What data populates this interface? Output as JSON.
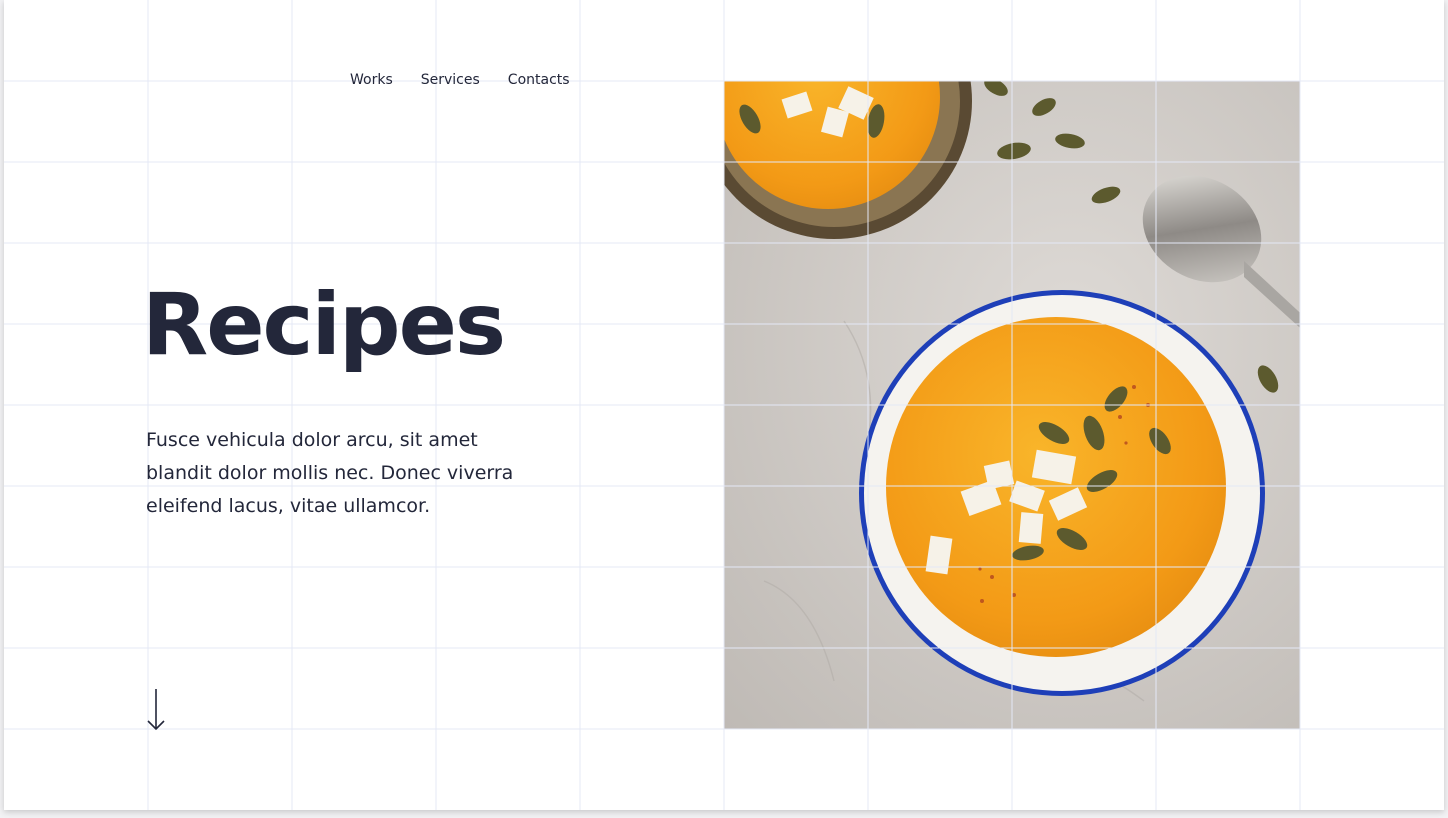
{
  "nav": {
    "items": [
      {
        "label": "Works"
      },
      {
        "label": "Services"
      },
      {
        "label": "Contacts"
      }
    ]
  },
  "hero": {
    "title": "Recipes",
    "description": "Fusce vehicula dolor arcu, sit amet blandit dolor mollis nec. Donec viverra eleifend lacus, vitae ullamcor.",
    "scroll_icon": "arrow-down-icon",
    "image_subject": "bowls of orange pumpkin soup with pumpkin seeds, feta and a spoon on a stone surface"
  },
  "colors": {
    "text": "#23273a",
    "background": "#ffffff",
    "grid_line": "#e4e8f6",
    "soup": "#f4a21c",
    "bowl_rim": "#1e3fb8",
    "stone": "#cfcbc6"
  }
}
